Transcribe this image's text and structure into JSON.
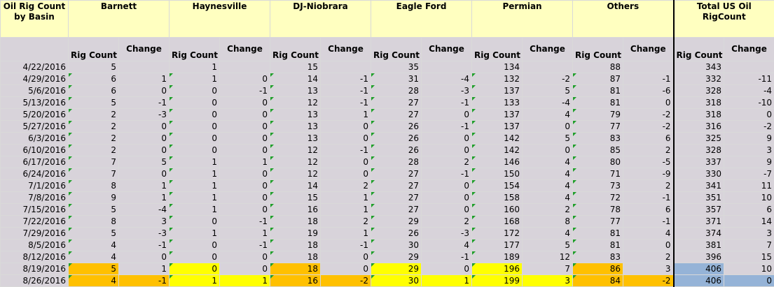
{
  "title": "Oil Rig Count by Basin",
  "basins": [
    "Barnett",
    "Haynesville",
    "DJ-Niobrara",
    "Eagle Ford",
    "Permian",
    "Others",
    "Total US Oil RigCount"
  ],
  "subheaders": {
    "rig_count": "Rig Count",
    "change": "Change"
  },
  "rows": [
    {
      "date": "4/22/2016",
      "v": [
        [
          5,
          null
        ],
        [
          1,
          null
        ],
        [
          15,
          null
        ],
        [
          35,
          null
        ],
        [
          134,
          null
        ],
        [
          88,
          null
        ],
        [
          343,
          null
        ]
      ]
    },
    {
      "date": "4/29/2016",
      "v": [
        [
          6,
          1
        ],
        [
          1,
          0
        ],
        [
          14,
          -1
        ],
        [
          31,
          -4
        ],
        [
          132,
          -2
        ],
        [
          87,
          -1
        ],
        [
          332,
          -11
        ]
      ]
    },
    {
      "date": "5/6/2016",
      "v": [
        [
          6,
          0
        ],
        [
          0,
          -1
        ],
        [
          13,
          -1
        ],
        [
          28,
          -3
        ],
        [
          137,
          5
        ],
        [
          81,
          -6
        ],
        [
          328,
          -4
        ]
      ]
    },
    {
      "date": "5/13/2016",
      "v": [
        [
          5,
          -1
        ],
        [
          0,
          0
        ],
        [
          12,
          -1
        ],
        [
          27,
          -1
        ],
        [
          133,
          -4
        ],
        [
          81,
          0
        ],
        [
          318,
          -10
        ]
      ]
    },
    {
      "date": "5/20/2016",
      "v": [
        [
          2,
          -3
        ],
        [
          0,
          0
        ],
        [
          13,
          1
        ],
        [
          27,
          0
        ],
        [
          137,
          4
        ],
        [
          79,
          -2
        ],
        [
          318,
          0
        ]
      ]
    },
    {
      "date": "5/27/2016",
      "v": [
        [
          2,
          0
        ],
        [
          0,
          0
        ],
        [
          13,
          0
        ],
        [
          26,
          -1
        ],
        [
          137,
          0
        ],
        [
          77,
          -2
        ],
        [
          316,
          -2
        ]
      ]
    },
    {
      "date": "6/3/2016",
      "v": [
        [
          2,
          0
        ],
        [
          0,
          0
        ],
        [
          13,
          0
        ],
        [
          26,
          0
        ],
        [
          142,
          5
        ],
        [
          83,
          6
        ],
        [
          325,
          9
        ]
      ]
    },
    {
      "date": "6/10/2016",
      "v": [
        [
          2,
          0
        ],
        [
          0,
          0
        ],
        [
          12,
          -1
        ],
        [
          26,
          0
        ],
        [
          142,
          0
        ],
        [
          85,
          2
        ],
        [
          328,
          3
        ]
      ]
    },
    {
      "date": "6/17/2016",
      "v": [
        [
          7,
          5
        ],
        [
          1,
          1
        ],
        [
          12,
          0
        ],
        [
          28,
          2
        ],
        [
          146,
          4
        ],
        [
          80,
          -5
        ],
        [
          337,
          9
        ]
      ]
    },
    {
      "date": "6/24/2016",
      "v": [
        [
          7,
          0
        ],
        [
          1,
          0
        ],
        [
          12,
          0
        ],
        [
          27,
          -1
        ],
        [
          150,
          4
        ],
        [
          71,
          -9
        ],
        [
          330,
          -7
        ]
      ]
    },
    {
      "date": "7/1/2016",
      "v": [
        [
          8,
          1
        ],
        [
          1,
          0
        ],
        [
          14,
          2
        ],
        [
          27,
          0
        ],
        [
          154,
          4
        ],
        [
          73,
          2
        ],
        [
          341,
          11
        ]
      ]
    },
    {
      "date": "7/8/2016",
      "v": [
        [
          9,
          1
        ],
        [
          1,
          0
        ],
        [
          15,
          1
        ],
        [
          27,
          0
        ],
        [
          158,
          4
        ],
        [
          72,
          -1
        ],
        [
          351,
          10
        ]
      ]
    },
    {
      "date": "7/15/2016",
      "v": [
        [
          5,
          -4
        ],
        [
          1,
          0
        ],
        [
          16,
          1
        ],
        [
          27,
          0
        ],
        [
          160,
          2
        ],
        [
          78,
          6
        ],
        [
          357,
          6
        ]
      ]
    },
    {
      "date": "7/22/2016",
      "v": [
        [
          8,
          3
        ],
        [
          0,
          -1
        ],
        [
          18,
          2
        ],
        [
          29,
          2
        ],
        [
          168,
          8
        ],
        [
          77,
          -1
        ],
        [
          371,
          14
        ]
      ]
    },
    {
      "date": "7/29/2016",
      "v": [
        [
          5,
          -3
        ],
        [
          1,
          1
        ],
        [
          19,
          1
        ],
        [
          26,
          -3
        ],
        [
          172,
          4
        ],
        [
          81,
          4
        ],
        [
          374,
          3
        ]
      ]
    },
    {
      "date": "8/5/2016",
      "v": [
        [
          4,
          -1
        ],
        [
          0,
          -1
        ],
        [
          18,
          -1
        ],
        [
          30,
          4
        ],
        [
          177,
          5
        ],
        [
          81,
          0
        ],
        [
          381,
          7
        ]
      ]
    },
    {
      "date": "8/12/2016",
      "v": [
        [
          4,
          0
        ],
        [
          0,
          0
        ],
        [
          18,
          0
        ],
        [
          29,
          -1
        ],
        [
          189,
          12
        ],
        [
          83,
          2
        ],
        [
          396,
          15
        ]
      ]
    },
    {
      "date": "8/19/2016",
      "v": [
        [
          5,
          1
        ],
        [
          0,
          0
        ],
        [
          18,
          0
        ],
        [
          29,
          0
        ],
        [
          196,
          7
        ],
        [
          86,
          3
        ],
        [
          406,
          10
        ]
      ]
    },
    {
      "date": "8/26/2016",
      "v": [
        [
          4,
          -1
        ],
        [
          1,
          1
        ],
        [
          16,
          -2
        ],
        [
          30,
          1
        ],
        [
          199,
          3
        ],
        [
          84,
          -2
        ],
        [
          406,
          0
        ]
      ]
    }
  ],
  "highlight_colors": {
    "yellow": "#ffff00",
    "orange": "#ffc000",
    "blue": "#95b3d7",
    "header": "#ffffc0",
    "body": "#d8d3da",
    "marker": "#1f9e2a"
  }
}
